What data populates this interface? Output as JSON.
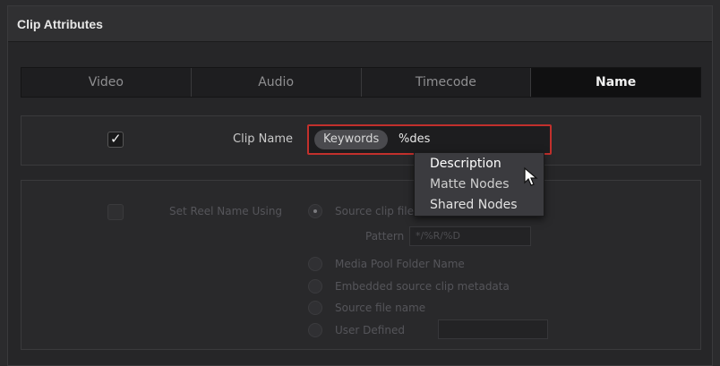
{
  "window": {
    "title": "Clip Attributes"
  },
  "tabs": [
    {
      "label": "Video",
      "active": false
    },
    {
      "label": "Audio",
      "active": false
    },
    {
      "label": "Timecode",
      "active": false
    },
    {
      "label": "Name",
      "active": true
    }
  ],
  "clip_name": {
    "label": "Clip Name",
    "checked": true,
    "token": "Keywords",
    "value": "%des"
  },
  "reel": {
    "label": "Set Reel Name Using",
    "options": [
      {
        "label": "Source clip file",
        "selected": true
      },
      {
        "label": "Media Pool Folder Name"
      },
      {
        "label": "Embedded source clip metadata"
      },
      {
        "label": "Source file name"
      },
      {
        "label": "User Defined"
      }
    ],
    "pattern_label": "Pattern",
    "pattern_value": "*/%R/%D"
  },
  "dropdown": {
    "items": [
      "Description",
      "Matte Nodes",
      "Shared Nodes"
    ],
    "highlighted": "Description"
  }
}
